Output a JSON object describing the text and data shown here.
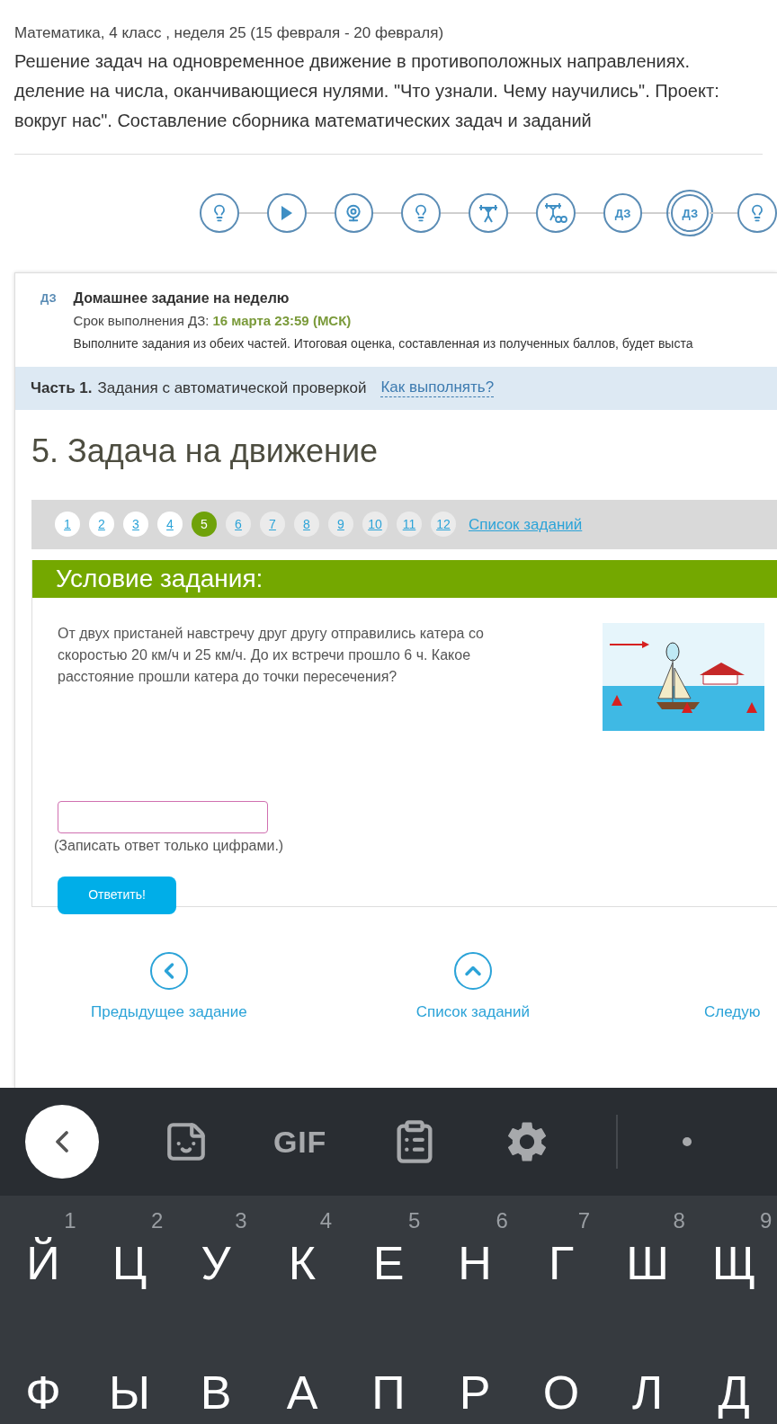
{
  "breadcrumb": "Математика, 4 класс , неделя 25 (15 февраля - 20 февраля)",
  "lesson_title_lines": [
    "Решение задач на одновременное движение в противоположных направлениях.",
    "деление на числа, оканчивающиеся нулями. \"Что узнали. Чему научились\". Проект:",
    "вокруг нас\". Составление сборника математических задач и заданий"
  ],
  "steps": [
    {
      "kind": "bulb",
      "selected": false
    },
    {
      "kind": "play",
      "selected": false
    },
    {
      "kind": "webcam",
      "selected": false
    },
    {
      "kind": "bulb",
      "selected": false
    },
    {
      "kind": "lifter",
      "selected": false
    },
    {
      "kind": "lifter-infinity",
      "selected": false
    },
    {
      "kind": "text",
      "label": "ДЗ",
      "selected": false
    },
    {
      "kind": "text",
      "label": "ДЗ",
      "selected": true
    },
    {
      "kind": "bulb",
      "selected": false
    }
  ],
  "homework": {
    "badge": "ДЗ",
    "title": "Домашнее задание на неделю",
    "deadline_label": "Срок выполнения ДЗ:",
    "deadline": "16 марта 23:59 (МСК)",
    "note": "Выполните задания из обеих частей. Итоговая оценка, составленная из полученных баллов, будет выста"
  },
  "part": {
    "label": "Часть 1.",
    "text": "Задания с автоматической проверкой",
    "help_link": "Как выполнять?"
  },
  "task_heading": "5. Задача на движение",
  "pager": {
    "items": [
      {
        "label": "1",
        "visited": true,
        "selected": false
      },
      {
        "label": "2",
        "visited": true,
        "selected": false
      },
      {
        "label": "3",
        "visited": true,
        "selected": false
      },
      {
        "label": "4",
        "visited": true,
        "selected": false
      },
      {
        "label": "5",
        "selected": true
      },
      {
        "label": "6",
        "visited": false,
        "selected": false
      },
      {
        "label": "7",
        "visited": false,
        "selected": false
      },
      {
        "label": "8",
        "visited": false,
        "selected": false
      },
      {
        "label": "9",
        "visited": false,
        "selected": false
      },
      {
        "label": "10",
        "visited": false,
        "selected": false
      },
      {
        "label": "11",
        "visited": false,
        "selected": false
      },
      {
        "label": "12",
        "visited": false,
        "selected": false
      }
    ],
    "list_link": "Список заданий"
  },
  "task": {
    "header": "Условие задания:",
    "text": "От двух пристаней навстречу друг другу отправились катера со скоростью 20 км/ч и 25 км/ч. До их встречи прошло 6 ч. Какое расстояние прошли катера до точки пересечения?",
    "hint": "(Записать ответ только цифрами.)",
    "submit": "Ответить!"
  },
  "nav": [
    {
      "kind": "prev",
      "label": "Предыдущее задание"
    },
    {
      "kind": "up",
      "label": "Список заданий"
    },
    {
      "kind": "next",
      "label": "Следую"
    }
  ],
  "keyboard": {
    "toolbar": [
      {
        "kind": "back"
      },
      {
        "kind": "sticker"
      },
      {
        "kind": "gif",
        "label": "GIF"
      },
      {
        "kind": "clipboard"
      },
      {
        "kind": "settings"
      },
      {
        "kind": "divider"
      },
      {
        "kind": "more"
      }
    ],
    "rows": [
      [
        {
          "key": "Й",
          "hint": "1"
        },
        {
          "key": "Ц",
          "hint": "2"
        },
        {
          "key": "У",
          "hint": "3"
        },
        {
          "key": "К",
          "hint": "4"
        },
        {
          "key": "Е",
          "hint": "5"
        },
        {
          "key": "Н",
          "hint": "6"
        },
        {
          "key": "Г",
          "hint": "7"
        },
        {
          "key": "Ш",
          "hint": "8"
        },
        {
          "key": "Щ",
          "hint": "9"
        }
      ],
      [
        {
          "key": "Ф"
        },
        {
          "key": "Ы"
        },
        {
          "key": "В"
        },
        {
          "key": "А"
        },
        {
          "key": "П"
        },
        {
          "key": "Р"
        },
        {
          "key": "О"
        },
        {
          "key": "Л"
        },
        {
          "key": "Д"
        }
      ]
    ]
  }
}
